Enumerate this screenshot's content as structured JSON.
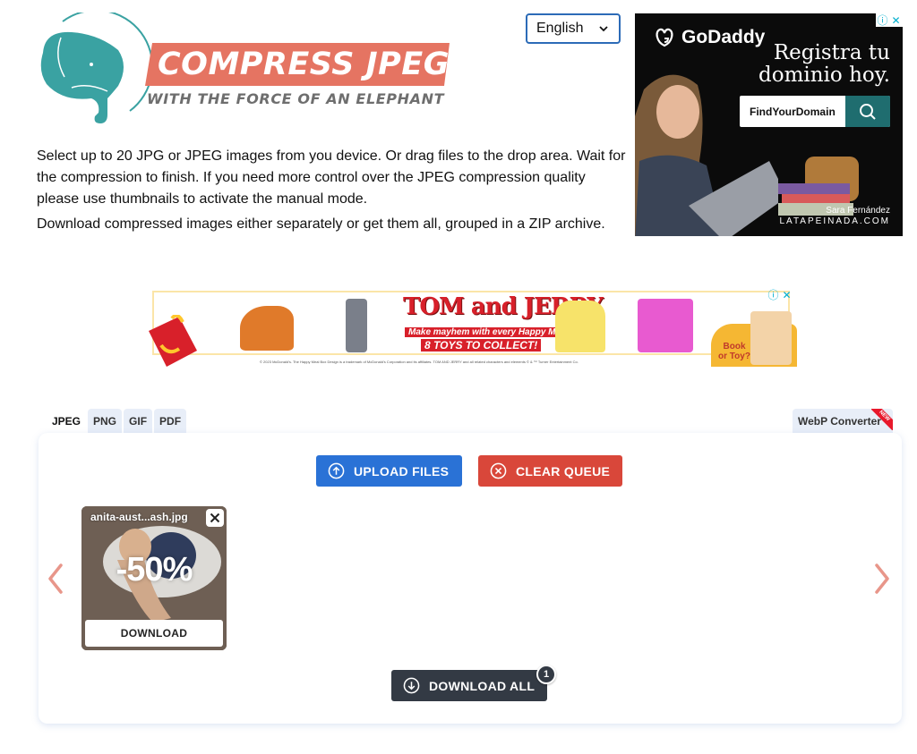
{
  "logo": {
    "title": "COMPRESS JPEG",
    "tagline": "WITH THE FORCE OF AN ELEPHANT",
    "colors": {
      "elephant": "#3aa2a2",
      "banner": "#e57462",
      "tagline": "#6e6e6e"
    }
  },
  "language": {
    "selected": "English"
  },
  "intro": {
    "paragraph1": "Select up to 20 JPG or JPEG images from you device. Or drag files to the drop area. Wait for the compression to finish. If you need more control over the JPEG compression quality please use thumbnails to activate the manual mode.",
    "paragraph2": "Download compressed images either separately or get them all, grouped in a ZIP archive."
  },
  "ads": {
    "godaddy": {
      "brand": "GoDaddy",
      "headline_line1": "Registra tu",
      "headline_line2": "dominio hoy.",
      "search_text": "FindYourDomain",
      "credit_name": "Sara Fernández",
      "credit_site": "LATAPEINADA.COM",
      "info_icon": "ⓘ",
      "close_icon": "✕"
    },
    "mcdonalds": {
      "title": "TOM and JERRY",
      "subtitle": "Make mayhem with every Happy Meal!",
      "cta": "8 TOYS TO COLLECT!",
      "book_text": "Book or Toy?",
      "legal": "© 2023 McDonald's. The Happy Meal Box Design is a trademark of McDonald's Corporation and its affiliates. TOM AND JERRY and all related characters and elements © & ™ Turner Entertainment Co.",
      "info_icon": "ⓘ",
      "close_icon": "✕"
    }
  },
  "tabs": [
    {
      "label": "JPEG",
      "active": true
    },
    {
      "label": "PNG",
      "active": false
    },
    {
      "label": "GIF",
      "active": false
    },
    {
      "label": "PDF",
      "active": false
    }
  ],
  "webp_tab": {
    "label": "WebP Converter",
    "ribbon": "NEW"
  },
  "panel": {
    "upload_label": "UPLOAD FILES",
    "clear_label": "CLEAR QUEUE",
    "download_all_label": "DOWNLOAD ALL",
    "download_count": "1",
    "colors": {
      "upload": "#2a72d6",
      "clear": "#d9473a",
      "download_all": "#333a44",
      "arrows": "#e8968a"
    }
  },
  "files": [
    {
      "name": "anita-aust...ash.jpg",
      "reduction": "-50%",
      "download_label": "DOWNLOAD"
    }
  ]
}
